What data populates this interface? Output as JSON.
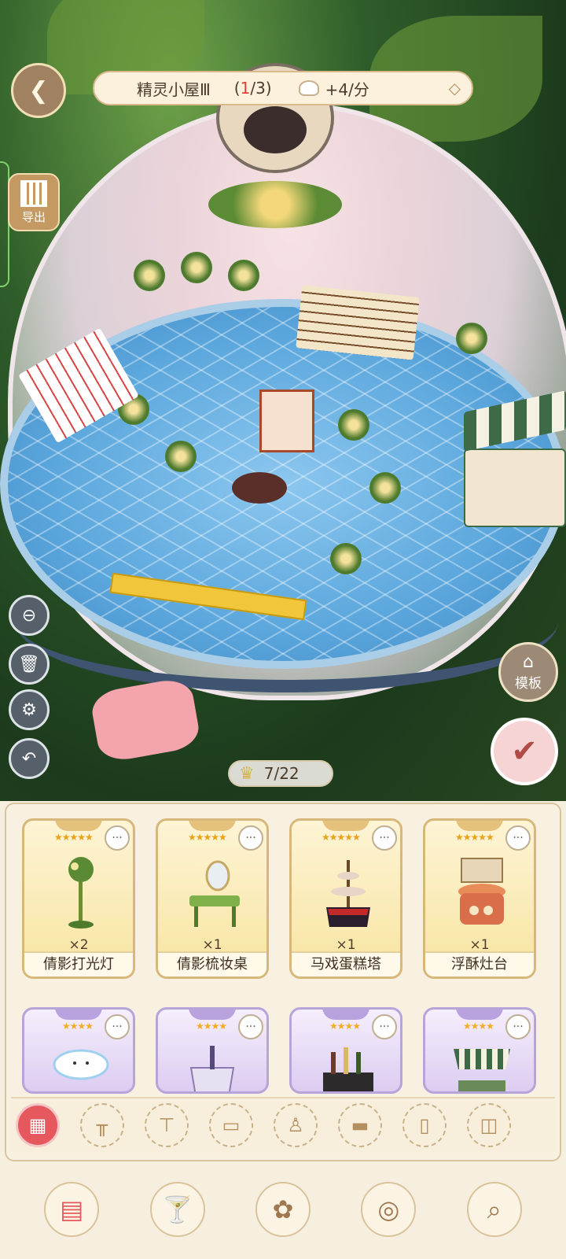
{
  "header": {
    "back_icon": "wing-back-icon",
    "room_name": "精灵小屋Ⅲ",
    "room_count_open": "(",
    "room_count_current": "1",
    "room_count_rest": "/3)",
    "rate": "+4/分"
  },
  "export": {
    "label": "导出"
  },
  "left_tools": [
    {
      "name": "hide-ui-button",
      "icon": "⊖"
    },
    {
      "name": "recycle-bin-button",
      "icon": "🗑"
    },
    {
      "name": "settings-button",
      "icon": "⚙"
    },
    {
      "name": "undo-button",
      "icon": "↶"
    }
  ],
  "template": {
    "label": "模板"
  },
  "capacity": {
    "text": "7/22"
  },
  "inventory": {
    "cards": [
      {
        "stars": "★★★★★",
        "qty": "×2",
        "name": "倩影打光灯",
        "tier": "gold"
      },
      {
        "stars": "★★★★★",
        "qty": "×1",
        "name": "倩影梳妆桌",
        "tier": "gold"
      },
      {
        "stars": "★★★★★",
        "qty": "×1",
        "name": "马戏蛋糕塔",
        "tier": "gold"
      },
      {
        "stars": "★★★★★",
        "qty": "×1",
        "name": "浮酥灶台",
        "tier": "gold"
      },
      {
        "stars": "★★★★",
        "tier": "purple"
      },
      {
        "stars": "★★★★",
        "tier": "purple"
      },
      {
        "stars": "★★★★",
        "tier": "purple"
      },
      {
        "stars": "★★★★",
        "tier": "purple"
      }
    ],
    "more_label": "···"
  },
  "categories": [
    "all",
    "table",
    "round-table",
    "sofa",
    "chair",
    "bed",
    "cabinet",
    "stove",
    "lamp"
  ],
  "bottom_nav": [
    "furniture",
    "drinks",
    "flowers",
    "planet",
    "search"
  ],
  "colors": {
    "accent": "#e4585e",
    "gold": "#d8b87a",
    "purple": "#b7a4d8"
  }
}
